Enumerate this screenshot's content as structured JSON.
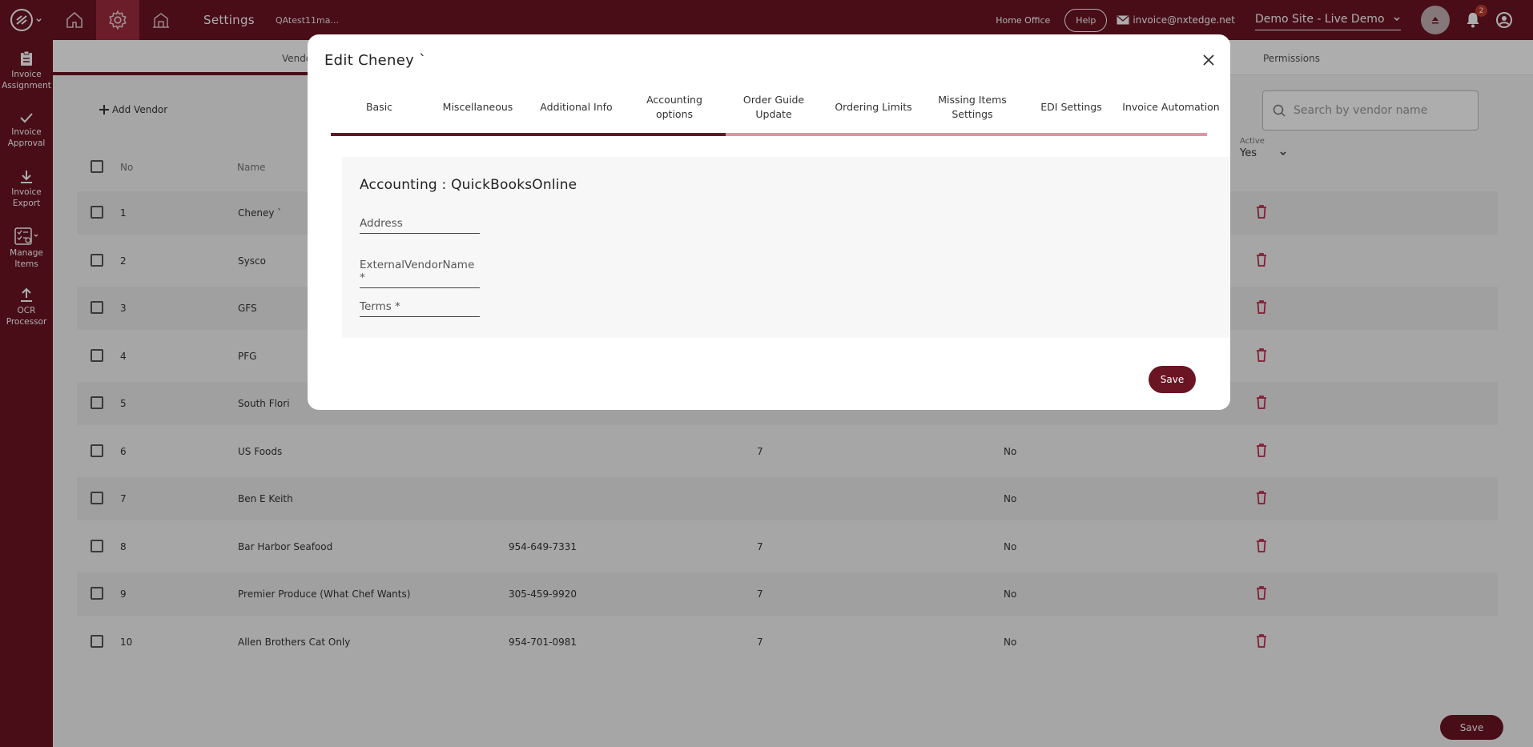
{
  "topbar": {
    "title": "Settings",
    "user": "QAtest11ma...",
    "home_office": "Home Office",
    "help": "Help",
    "email": "invoice@nxtedge.net",
    "site": "Demo Site - Live Demo",
    "notification_count": "2",
    "brand_color": "#6b1423"
  },
  "sidebar": {
    "items": [
      {
        "line1": "Invoice",
        "line2": "Assignment",
        "icon": "clipboard-icon"
      },
      {
        "line1": "Invoice",
        "line2": "Approval",
        "icon": "check-icon"
      },
      {
        "line1": "Invoice",
        "line2": "Export",
        "icon": "download-icon"
      },
      {
        "line1": "Manage",
        "line2": "Items",
        "icon": "checklist-icon"
      },
      {
        "line1": "OCR",
        "line2": "Processor",
        "icon": "upload-icon"
      }
    ]
  },
  "page": {
    "subnav_left": "Vendo",
    "subnav_right": "Permissions",
    "add_vendor": "Add Vendor",
    "search_placeholder": "Search by vendor name",
    "active_label": "Active",
    "active_value": "Yes",
    "col_no": "No",
    "col_name": "Name",
    "save": "Save",
    "rows": [
      {
        "no": "1",
        "name": "Cheney `",
        "phone": "",
        "days": "",
        "edi": ""
      },
      {
        "no": "2",
        "name": "Sysco",
        "phone": "",
        "days": "",
        "edi": ""
      },
      {
        "no": "3",
        "name": "GFS",
        "phone": "",
        "days": "",
        "edi": ""
      },
      {
        "no": "4",
        "name": "PFG",
        "phone": "",
        "days": "",
        "edi": ""
      },
      {
        "no": "5",
        "name": "South Flori",
        "phone": "",
        "days": "",
        "edi": ""
      },
      {
        "no": "6",
        "name": "US Foods",
        "phone": "",
        "days": "7",
        "edi": "No"
      },
      {
        "no": "7",
        "name": "Ben E Keith",
        "phone": "",
        "days": "",
        "edi": "No"
      },
      {
        "no": "8",
        "name": "Bar Harbor Seafood",
        "phone": "954-649-7331",
        "days": "7",
        "edi": "No"
      },
      {
        "no": "9",
        "name": "Premier Produce (What Chef Wants)",
        "phone": "305-459-9920",
        "days": "7",
        "edi": "No"
      },
      {
        "no": "10",
        "name": "Allen Brothers Cat Only",
        "phone": "954-701-0981",
        "days": "7",
        "edi": "No"
      }
    ]
  },
  "modal": {
    "title": "Edit Cheney `",
    "tabs": [
      {
        "label": "Basic"
      },
      {
        "label": "Miscellaneous"
      },
      {
        "label": "Additional Info"
      },
      {
        "label": "Accounting options"
      },
      {
        "label": "Order Guide Update"
      },
      {
        "label": "Ordering Limits"
      },
      {
        "label": "Missing Items Settings"
      },
      {
        "label": "EDI Settings"
      },
      {
        "label": "Invoice Automation"
      }
    ],
    "active_tab": "Accounting options",
    "accounting_title": "Accounting : QuickBooksOnline",
    "fields": {
      "address": "Address",
      "external_vendor_name": "ExternalVendorName *",
      "terms": "Terms *"
    },
    "save": "Save"
  }
}
